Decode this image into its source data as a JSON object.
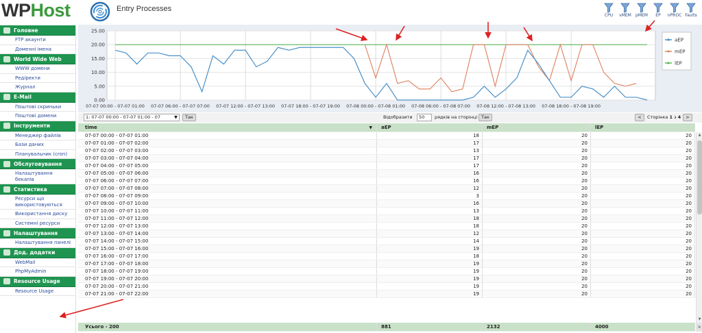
{
  "header": {
    "logo_wp": "WP",
    "logo_host": "Host",
    "page_title": "Entry Processes",
    "filters": [
      {
        "label": "CPU",
        "icon": "filter-icon"
      },
      {
        "label": "vMEM",
        "icon": "filter-icon"
      },
      {
        "label": "pMEM",
        "icon": "filter-icon"
      },
      {
        "label": "EP",
        "icon": "filter-icon"
      },
      {
        "label": "nPROC",
        "icon": "filter-icon"
      },
      {
        "label": "Faults",
        "icon": "filter-icon"
      }
    ]
  },
  "sidebar": {
    "sections": [
      {
        "title": "Головне",
        "items": [
          "FTP акаунти",
          "Доменні імена"
        ]
      },
      {
        "title": "World Wide Web",
        "items": [
          "WWW домени",
          "Редіректи",
          "Журнал"
        ]
      },
      {
        "title": "E-Mail",
        "items": [
          "Поштові скриньки",
          "Поштові домени"
        ]
      },
      {
        "title": "Інструменти",
        "items": [
          "Менеджер файлів",
          "Бази даних",
          "Планувальник (cron)"
        ]
      },
      {
        "title": "Обслуговування",
        "items": [
          "Налаштування бекапів"
        ]
      },
      {
        "title": "Статистика",
        "items": [
          "Ресурси що використовуються",
          "Використання диску",
          "Системні ресурси"
        ]
      },
      {
        "title": "Налаштування",
        "items": [
          "Налаштування панелі"
        ]
      },
      {
        "title": "Дод. додатки",
        "items": [
          "WebMail",
          "PhpMyAdmin"
        ]
      },
      {
        "title": "Resource Usage",
        "items": [
          "Resource Usage"
        ]
      }
    ]
  },
  "toolbar": {
    "range_value": "1: 07-07 00:00 - 07-07 01:00 - 07",
    "go_label": "Так",
    "show_label": "Відобразити",
    "rows_value": "50",
    "rows_label": "рядків на сторінці",
    "go2_label": "Так",
    "prev_label": "<",
    "page_prefix": "Сторінка",
    "page_current": "1",
    "page_of": "з",
    "page_total": "4",
    "next_label": ">"
  },
  "table": {
    "columns": [
      "time",
      "aEP",
      "mEP",
      "lEP"
    ],
    "rows": [
      [
        "07-07 00:00 - 07-07 01:00",
        "18",
        "20",
        "20"
      ],
      [
        "07-07 01:00 - 07-07 02:00",
        "17",
        "20",
        "20"
      ],
      [
        "07-07 02:00 - 07-07 03:00",
        "13",
        "20",
        "20"
      ],
      [
        "07-07 03:00 - 07-07 04:00",
        "17",
        "20",
        "20"
      ],
      [
        "07-07 04:00 - 07-07 05:00",
        "17",
        "20",
        "20"
      ],
      [
        "07-07 05:00 - 07-07 06:00",
        "16",
        "20",
        "20"
      ],
      [
        "07-07 06:00 - 07-07 07:00",
        "16",
        "20",
        "20"
      ],
      [
        "07-07 07:00 - 07-07 08:00",
        "12",
        "20",
        "20"
      ],
      [
        "07-07 08:00 - 07-07 09:00",
        "3",
        "20",
        "20"
      ],
      [
        "07-07 09:00 - 07-07 10:00",
        "16",
        "20",
        "20"
      ],
      [
        "07-07 10:00 - 07-07 11:00",
        "13",
        "20",
        "20"
      ],
      [
        "07-07 11:00 - 07-07 12:00",
        "18",
        "20",
        "20"
      ],
      [
        "07-07 12:00 - 07-07 13:00",
        "18",
        "20",
        "20"
      ],
      [
        "07-07 13:00 - 07-07 14:00",
        "12",
        "20",
        "20"
      ],
      [
        "07-07 14:00 - 07-07 15:00",
        "14",
        "20",
        "20"
      ],
      [
        "07-07 15:00 - 07-07 16:00",
        "19",
        "20",
        "20"
      ],
      [
        "07-07 16:00 - 07-07 17:00",
        "18",
        "20",
        "20"
      ],
      [
        "07-07 17:00 - 07-07 18:00",
        "19",
        "20",
        "20"
      ],
      [
        "07-07 18:00 - 07-07 19:00",
        "19",
        "20",
        "20"
      ],
      [
        "07-07 19:00 - 07-07 20:00",
        "19",
        "20",
        "20"
      ],
      [
        "07-07 20:00 - 07-07 21:00",
        "19",
        "20",
        "20"
      ],
      [
        "07-07 21:00 - 07-07 22:00",
        "19",
        "20",
        "20"
      ]
    ],
    "footer": [
      "Усього - 200",
      "881",
      "2132",
      "4000"
    ]
  },
  "chart_data": {
    "type": "line",
    "y_ticks": [
      "0.00",
      "5.00",
      "10.00",
      "15.00",
      "20.00",
      "25.00"
    ],
    "ylim": [
      0,
      25
    ],
    "x_tick_labels": [
      "07-07 00:00 - 07-07 01:00",
      "07-07 06:00 - 07-07 07:00",
      "07-07 12:00 - 07-07 13:00",
      "07-07 18:00 - 07-07 19:00",
      "07-08 00:00 - 07-08 01:00",
      "07-08 06:00 - 07-08 07:00",
      "07-08 12:00 - 07-08 13:00",
      "07-08 18:00 - 07-08 19:00"
    ],
    "x_tick_index": [
      0,
      6,
      12,
      18,
      24,
      30,
      36,
      42
    ],
    "grid": true,
    "legend": "right",
    "series": [
      {
        "name": "aEP",
        "color": "#4a90c8",
        "values": [
          18,
          17,
          13,
          17,
          17,
          16,
          16,
          12,
          3,
          16,
          13,
          18,
          18,
          12,
          14,
          19,
          18,
          19,
          19,
          19,
          19,
          19,
          15,
          6,
          1,
          6,
          0,
          0,
          0,
          0,
          0,
          0,
          0,
          1,
          5,
          1,
          4,
          8,
          18,
          13,
          7,
          1,
          1,
          5,
          4,
          1,
          5,
          1,
          1,
          0
        ]
      },
      {
        "name": "mEP",
        "color": "#e0886a",
        "values": [
          null,
          null,
          null,
          null,
          null,
          null,
          null,
          null,
          null,
          null,
          null,
          null,
          null,
          null,
          null,
          null,
          null,
          null,
          null,
          null,
          null,
          null,
          null,
          20,
          8,
          20,
          6,
          7,
          4,
          4,
          8,
          3,
          4,
          20,
          20,
          5,
          20,
          20,
          20,
          12,
          7,
          20,
          7,
          20,
          20,
          10,
          6,
          5,
          6,
          null
        ]
      },
      {
        "name": "lEP",
        "color": "#5cb85c",
        "values": [
          20,
          20,
          20,
          20,
          20,
          20,
          20,
          20,
          20,
          20,
          20,
          20,
          20,
          20,
          20,
          20,
          20,
          20,
          20,
          20,
          20,
          20,
          20,
          20,
          20,
          20,
          20,
          20,
          20,
          20,
          20,
          20,
          20,
          20,
          20,
          20,
          20,
          20,
          20,
          20,
          20,
          20,
          20,
          20,
          20,
          20,
          20,
          20,
          20,
          20
        ]
      }
    ]
  },
  "colors": {
    "accent_green": "#1e9450",
    "header_green": "#c8e1c8",
    "annotation_red": "#dd2222"
  }
}
